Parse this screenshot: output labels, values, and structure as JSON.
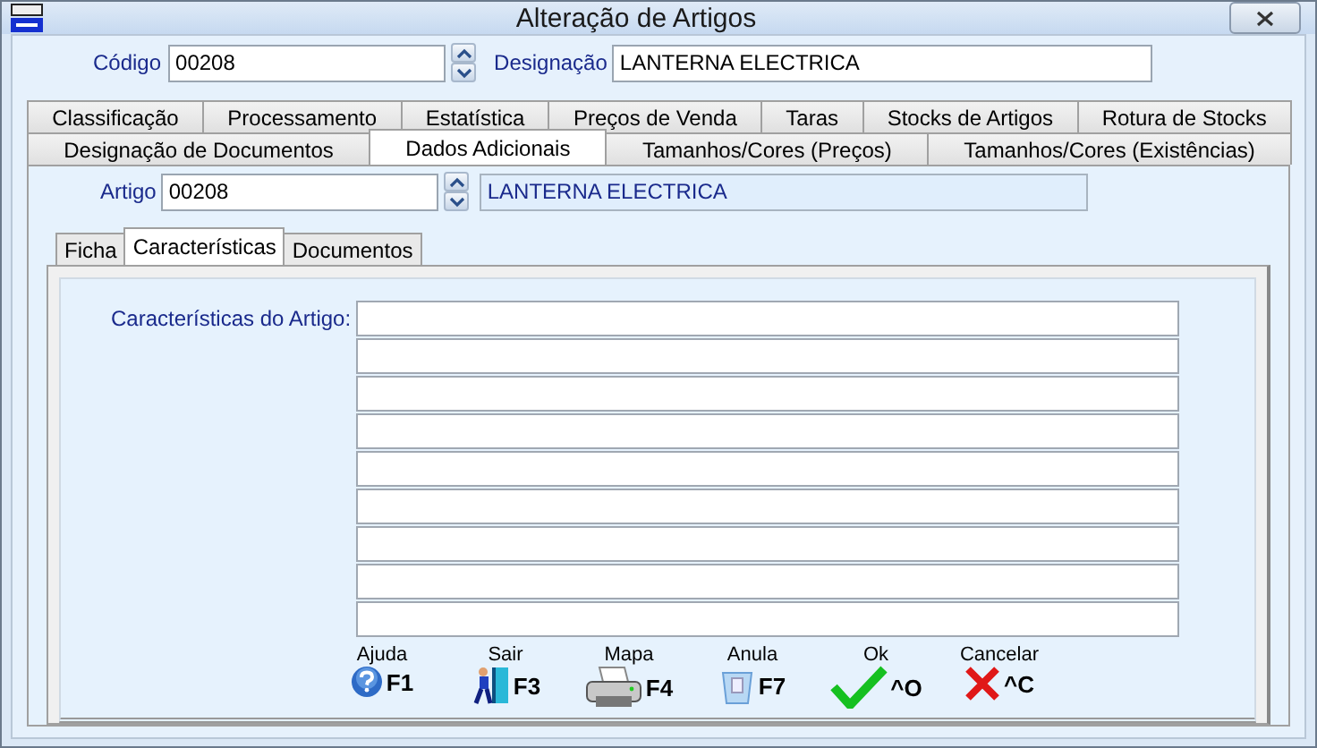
{
  "window": {
    "title": "Alteração de Artigos"
  },
  "header": {
    "code_label": "Código",
    "code": "00208",
    "designation_label": "Designação",
    "designation": "LANTERNA ELECTRICA"
  },
  "tab_rows": [
    [
      {
        "label": "Classificação",
        "selected": false
      },
      {
        "label": "Processamento",
        "selected": false
      },
      {
        "label": "Estatística",
        "selected": false
      },
      {
        "label": "Preços de Venda",
        "selected": false
      },
      {
        "label": "Taras",
        "selected": false
      },
      {
        "label": "Stocks de Artigos",
        "selected": false
      },
      {
        "label": "Rotura de Stocks",
        "selected": false
      }
    ],
    [
      {
        "label": "Designação de Documentos",
        "selected": false
      },
      {
        "label": "Dados Adicionais",
        "selected": true
      },
      {
        "label": "Tamanhos/Cores (Preços)",
        "selected": false
      },
      {
        "label": "Tamanhos/Cores (Existências)",
        "selected": false
      }
    ]
  ],
  "article": {
    "label": "Artigo",
    "code": "00208",
    "name": "LANTERNA ELECTRICA"
  },
  "subtabs": [
    {
      "label": "Ficha",
      "selected": false
    },
    {
      "label": "Características",
      "selected": true
    },
    {
      "label": "Documentos",
      "selected": false
    }
  ],
  "characteristics": {
    "label": "Características do Artigo:",
    "lines": [
      {
        "kind": "line"
      },
      {
        "kind": "line"
      },
      {
        "kind": "line"
      },
      {
        "kind": "line"
      },
      {
        "kind": "line"
      },
      {
        "kind": "line"
      },
      {
        "kind": "line"
      },
      {
        "kind": "line"
      },
      {
        "kind": "line"
      }
    ]
  },
  "toolbar": [
    {
      "kind": "help",
      "label": "Ajuda",
      "key": "F1"
    },
    {
      "kind": "exit",
      "label": "Sair",
      "key": "F3"
    },
    {
      "kind": "print",
      "label": "Mapa",
      "key": "F4"
    },
    {
      "kind": "undo",
      "label": "Anula",
      "key": "F7"
    },
    {
      "kind": "ok",
      "label": "Ok",
      "key": "^O"
    },
    {
      "kind": "cancel",
      "label": "Cancelar",
      "key": "^C"
    }
  ]
}
